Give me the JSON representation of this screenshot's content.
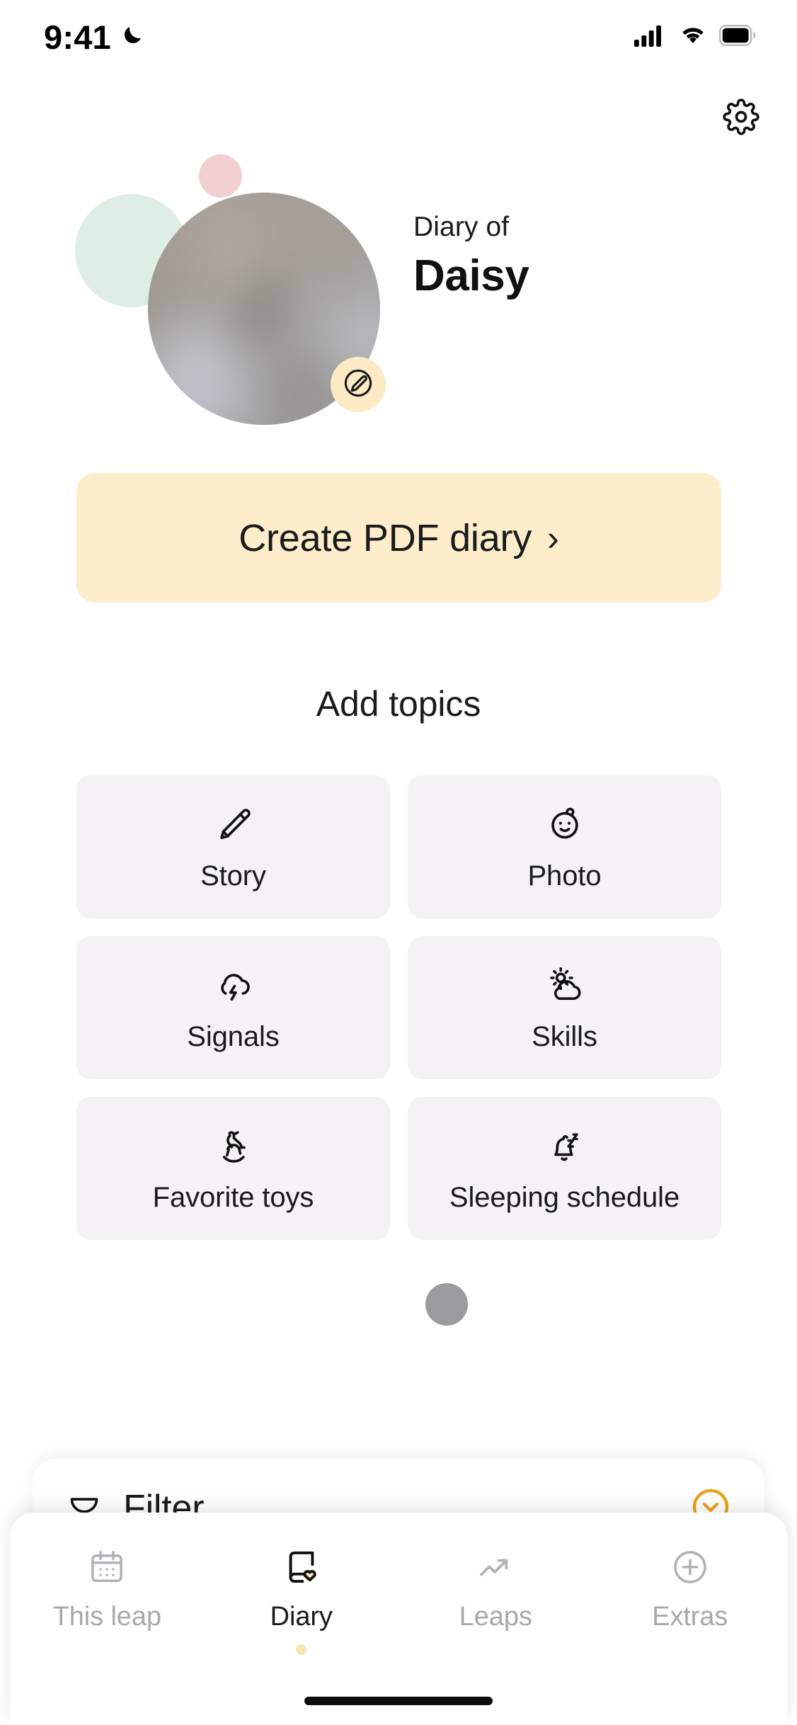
{
  "status_bar": {
    "time": "9:41",
    "dnd_icon": "crescent-moon-icon",
    "cellular_icon": "cellular-signal-icon",
    "wifi_icon": "wifi-icon",
    "battery_icon": "battery-full-icon"
  },
  "header": {
    "settings_icon": "gear-icon",
    "avatar_alt": "baby-avatar-photo",
    "edit_icon": "pencil-circle-icon",
    "subtitle": "Diary of",
    "name": "Daisy",
    "decor_pink_color": "#f2cfd1",
    "decor_mint_color": "#dfeee4",
    "edit_badge_color": "#fbeac4"
  },
  "cta": {
    "label": "Create PDF diary",
    "chevron": "›",
    "background_color": "#fdedcb"
  },
  "topics": {
    "title": "Add topics",
    "tile_background": "#f4f2f5",
    "items": [
      {
        "label": "Story",
        "icon": "pencil-icon"
      },
      {
        "label": "Photo",
        "icon": "baby-face-icon"
      },
      {
        "label": "Signals",
        "icon": "thunder-cloud-icon"
      },
      {
        "label": "Skills",
        "icon": "sun-behind-cloud-icon"
      },
      {
        "label": "Favorite toys",
        "icon": "rocking-horse-icon"
      },
      {
        "label": "Sleeping schedule",
        "icon": "sleeping-bell-icon"
      }
    ]
  },
  "avatar_placeholder": {
    "color": "#9b9b9e"
  },
  "filter": {
    "label": "Filter",
    "funnel_icon": "funnel-icon",
    "expand_icon": "chevron-down-circle-icon",
    "accent_color": "#e8a317"
  },
  "tab_bar": {
    "active_dot_color": "#fbe3b0",
    "tabs": [
      {
        "label": "This leap",
        "icon": "calendar-icon",
        "active": false
      },
      {
        "label": "Diary",
        "icon": "book-heart-icon",
        "active": true
      },
      {
        "label": "Leaps",
        "icon": "trending-up-icon",
        "active": false
      },
      {
        "label": "Extras",
        "icon": "plus-circle-icon",
        "active": false
      }
    ]
  }
}
